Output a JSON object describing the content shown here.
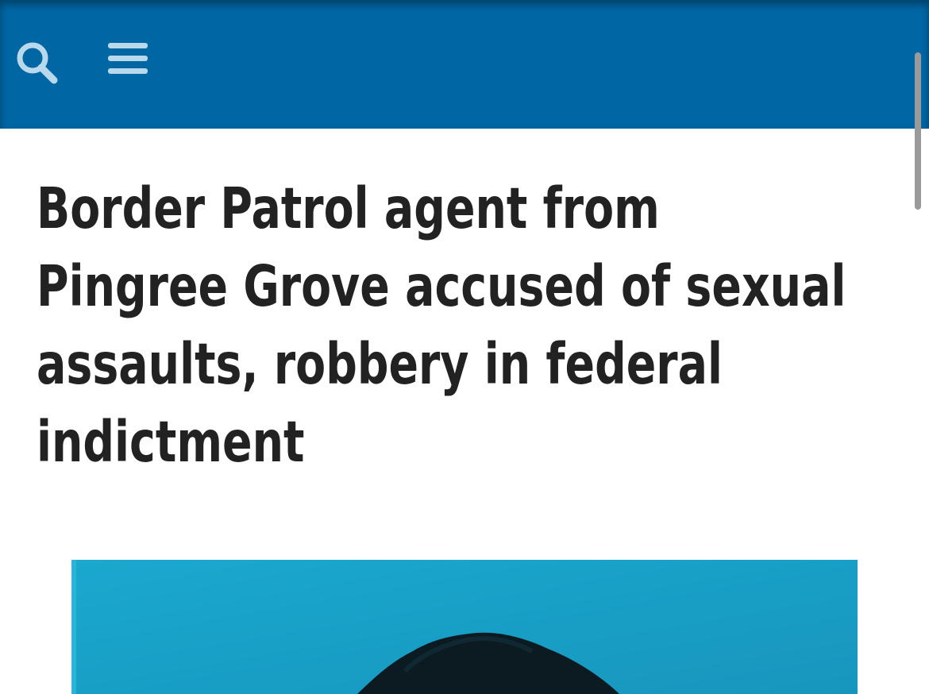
{
  "header": {
    "background_color": "#0066a4",
    "search_icon": "search-icon",
    "menu_icon": "hamburger-menu-icon"
  },
  "article": {
    "headline_lines": [
      "Border Patrol agent from",
      "Pingree Grove accused of sexual",
      "assaults, robbery in federal",
      "indictment"
    ],
    "photo": {
      "description_icon": "article-photo",
      "background_color": "#1a9fc6"
    }
  }
}
